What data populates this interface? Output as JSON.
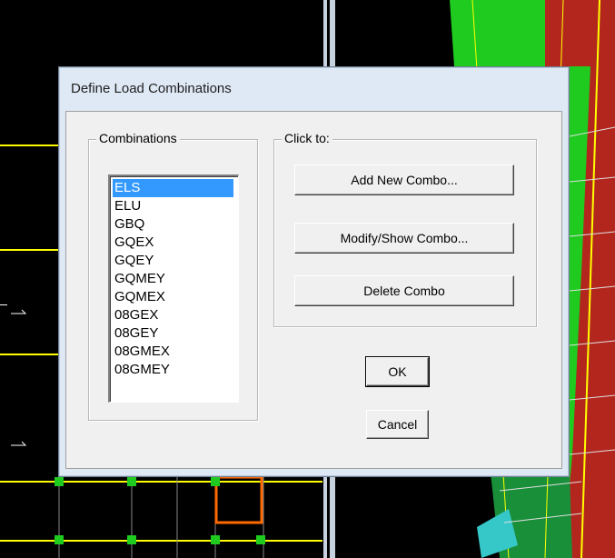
{
  "dialog": {
    "title": "Define Load Combinations",
    "combinations_group": "Combinations",
    "click_to_group": "Click to:",
    "combinations": [
      "ELS",
      "ELU",
      "GBQ",
      "GQEX",
      "GQEY",
      "GQMEY",
      "GQMEX",
      "08GEX",
      "08GEY",
      "08GMEX",
      "08GMEY"
    ],
    "selected_combination": "ELS",
    "buttons": {
      "add": "Add New Combo...",
      "modify": "Modify/Show Combo...",
      "delete": "Delete Combo",
      "ok": "OK",
      "cancel": "Cancel"
    }
  },
  "colors": {
    "selection": "#3399ff",
    "dialog_frame": "#dfe9f5",
    "model_green": "#1ecb1e",
    "model_red": "#b3261e",
    "grid_yellow": "#ffff00"
  }
}
